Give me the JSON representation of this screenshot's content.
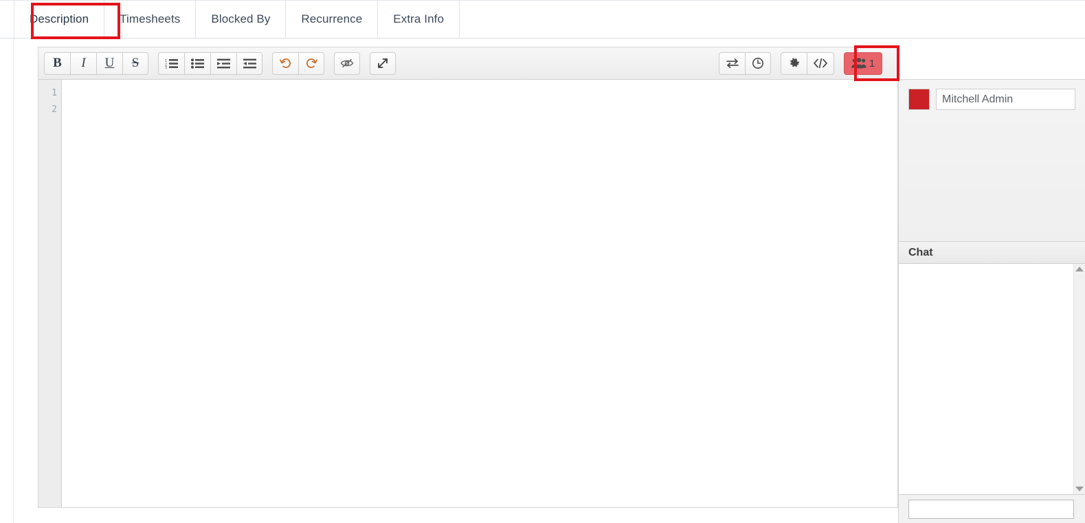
{
  "tabs": [
    {
      "label": "Description",
      "active": true,
      "name": "tab-description"
    },
    {
      "label": "Timesheets",
      "active": false,
      "name": "tab-timesheets"
    },
    {
      "label": "Blocked By",
      "active": false,
      "name": "tab-blocked-by"
    },
    {
      "label": "Recurrence",
      "active": false,
      "name": "tab-recurrence"
    },
    {
      "label": "Extra Info",
      "active": false,
      "name": "tab-extra-info"
    }
  ],
  "toolbar": {
    "bold_label": "B",
    "italic_label": "I",
    "underline_label": "U",
    "strike_label": "S",
    "ordered_list_icon": "ordered-list-icon",
    "unordered_list_icon": "unordered-list-icon",
    "indent_icon": "indent-icon",
    "outdent_icon": "outdent-icon",
    "undo_icon": "undo-icon",
    "redo_icon": "redo-icon",
    "preview_icon": "eye-slash-icon",
    "fullscreen_icon": "expand-arrows-icon",
    "sync_icon": "exchange-arrows-icon",
    "history_icon": "clock-icon",
    "settings_icon": "gear-icon",
    "code_icon": "code-icon",
    "collaborators_icon": "users-group-icon",
    "collaborators_count": "1"
  },
  "editor": {
    "line_numbers": [
      "1",
      "2"
    ],
    "content": "",
    "placeholder": ""
  },
  "right_panel": {
    "users": [
      {
        "name": "Mitchell Admin",
        "color": "#cc2027"
      }
    ],
    "chat": {
      "title": "Chat",
      "messages": [],
      "input_value": "",
      "input_placeholder": ""
    }
  },
  "colors": {
    "highlight_red": "#e4141b",
    "active_button_red": "#e8646a",
    "user_swatch": "#cc2027"
  }
}
